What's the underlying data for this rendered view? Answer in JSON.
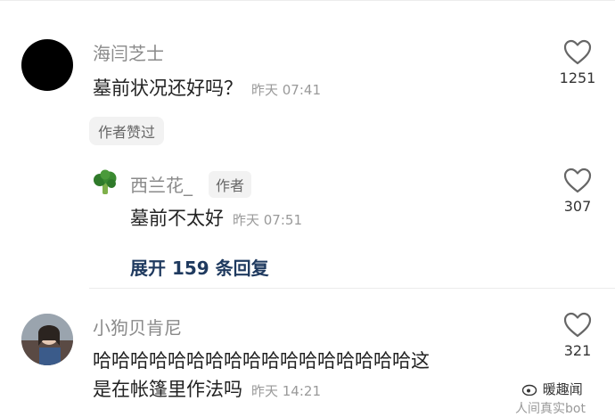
{
  "comments": [
    {
      "username": "海闫芝士",
      "text": "墓前状况还好吗？",
      "time": "昨天 07:41",
      "likes": "1251",
      "badge": "作者赞过"
    },
    {
      "username": "小狗贝肯尼",
      "text_line1": "哈哈哈哈哈哈哈哈哈哈哈哈哈哈哈哈哈这",
      "text_line2": "是在帐篷里作法吗",
      "time": "昨天 14:21",
      "likes": "321"
    }
  ],
  "reply": {
    "username": "西兰花_",
    "author_tag": "作者",
    "text": "墓前不太好",
    "time": "昨天 07:51",
    "likes": "307"
  },
  "expand_label": "展开 159 条回复",
  "watermark": {
    "name": "暖趣闻",
    "sub": "人间真实bot"
  },
  "colors": {
    "expand": "#1f3a5f",
    "username": "#8a8a8a",
    "time": "#9a9a9a"
  }
}
